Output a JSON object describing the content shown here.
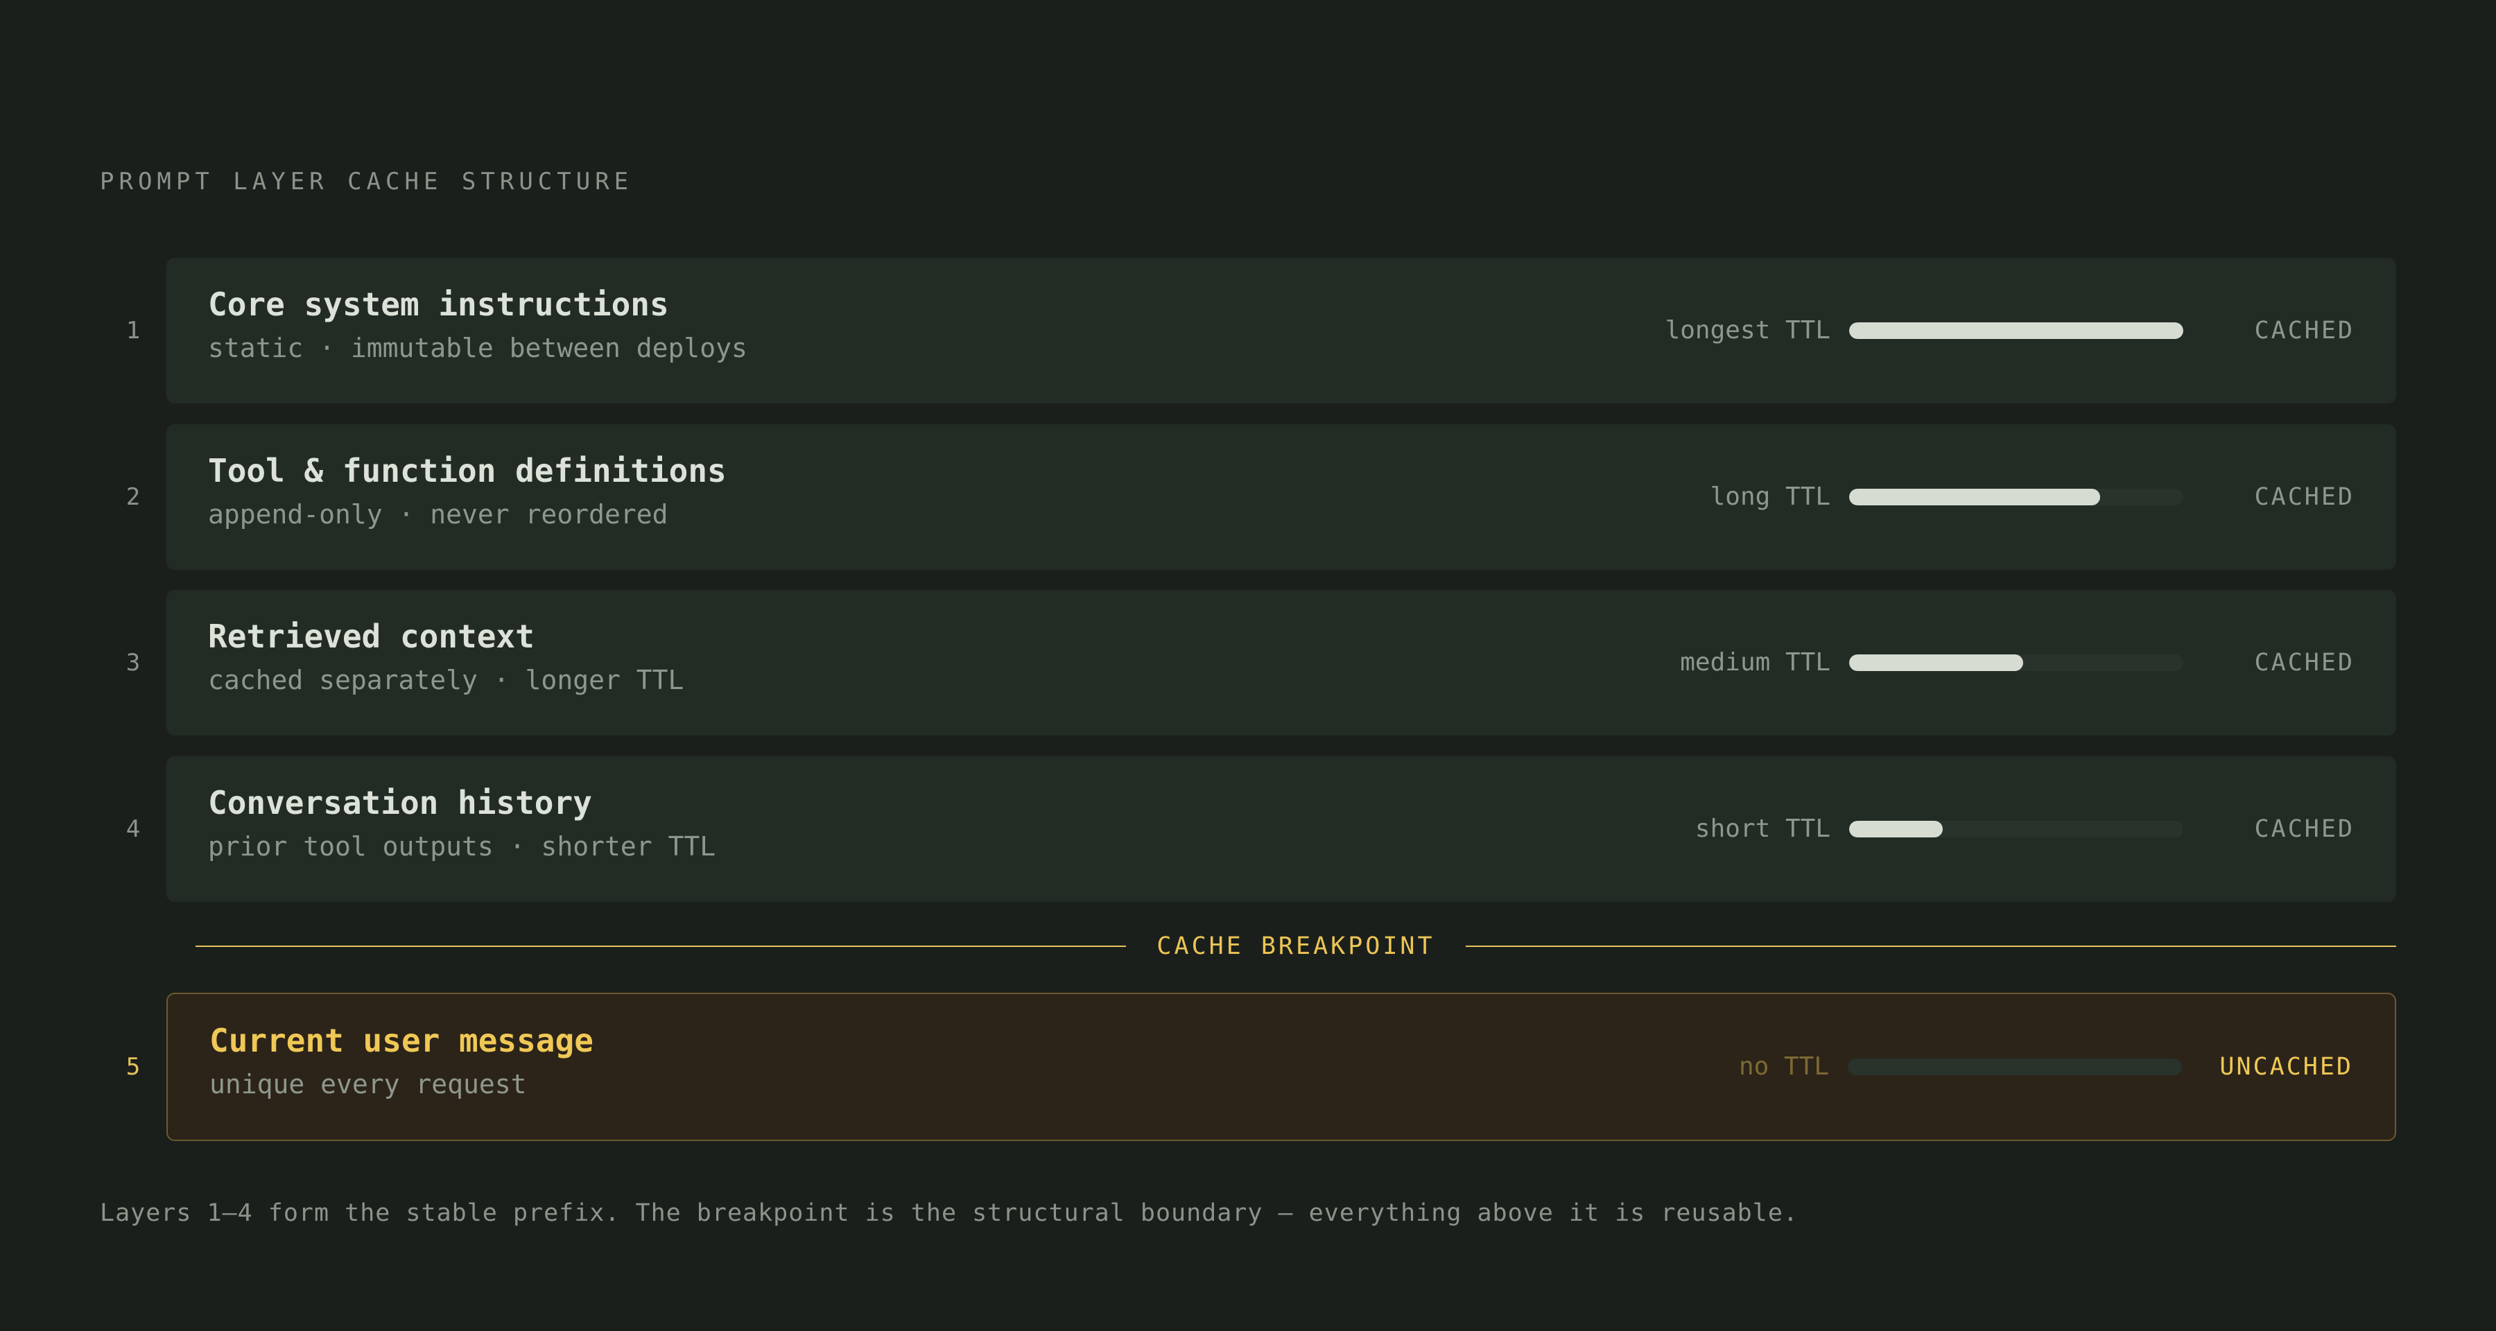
{
  "heading": "PROMPT LAYER CACHE STRUCTURE",
  "layers": [
    {
      "number": "1",
      "title": "Core system instructions",
      "subtitle": "static · immutable between deploys",
      "ttl_label": "longest TTL",
      "ttl_fraction": 1.0,
      "status": "CACHED"
    },
    {
      "number": "2",
      "title": "Tool & function definitions",
      "subtitle": "append-only · never reordered",
      "ttl_label": "long TTL",
      "ttl_fraction": 0.75,
      "status": "CACHED"
    },
    {
      "number": "3",
      "title": "Retrieved context",
      "subtitle": "cached separately · longer TTL",
      "ttl_label": "medium TTL",
      "ttl_fraction": 0.52,
      "status": "CACHED"
    },
    {
      "number": "4",
      "title": "Conversation history",
      "subtitle": "prior tool outputs · shorter TTL",
      "ttl_label": "short TTL",
      "ttl_fraction": 0.28,
      "status": "CACHED"
    },
    {
      "number": "5",
      "title": "Current user message",
      "subtitle": "unique every request",
      "ttl_label": "no TTL",
      "ttl_fraction": 0.0,
      "status": "UNCACHED"
    }
  ],
  "breakpoint_label": "CACHE BREAKPOINT",
  "footnote": "Layers 1–4 form the stable prefix. The breakpoint is the structural boundary — everything above it is reusable.",
  "colors": {
    "background": "#1b1f1c",
    "card": "#232b25",
    "accent": "#ecc555",
    "bar_fill": "#d6dcd2"
  }
}
